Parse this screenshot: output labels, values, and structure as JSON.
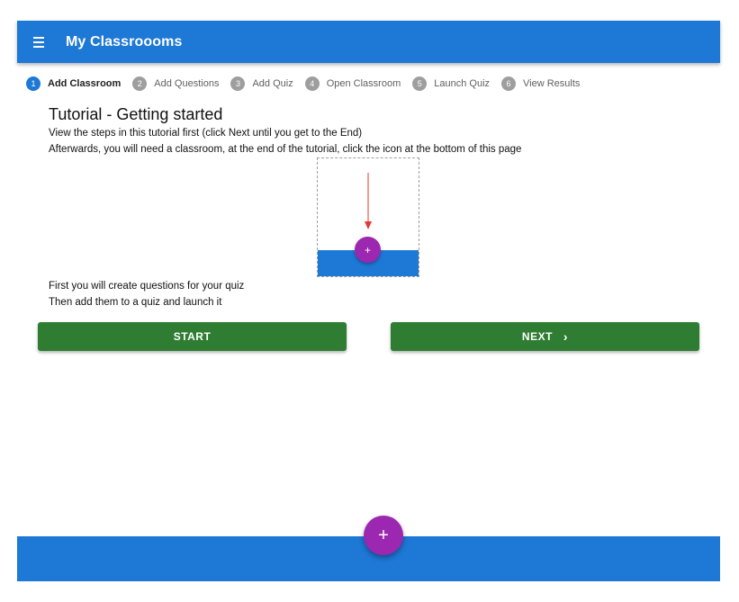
{
  "toolbar": {
    "title": "My Classroooms",
    "menu_icon": "menu-icon"
  },
  "stepper": {
    "steps": [
      {
        "number": "1",
        "label": "Add Classroom",
        "active": true
      },
      {
        "number": "2",
        "label": "Add Questions",
        "active": false
      },
      {
        "number": "3",
        "label": "Add Quiz",
        "active": false
      },
      {
        "number": "4",
        "label": "Open Classroom",
        "active": false
      },
      {
        "number": "5",
        "label": "Launch Quiz",
        "active": false
      },
      {
        "number": "6",
        "label": "View Results",
        "active": false
      }
    ]
  },
  "tutorial": {
    "heading": "Tutorial - Getting started",
    "line1": "View the steps in this tutorial first (click Next until you get to the End)",
    "line2": "Afterwards, you will need a classroom, at the end of the tutorial, click the icon at the bottom of this page",
    "illustration": {
      "fab_symbol": "+",
      "arrow_color": "#e53935"
    },
    "line3": "First you will create questions for your quiz",
    "line4": "Then add them to a quiz and launch it"
  },
  "buttons": {
    "start": "START",
    "next": "NEXT",
    "next_icon": "›"
  },
  "fab": {
    "symbol": "+"
  },
  "colors": {
    "primary": "#1e78d6",
    "accent": "#9c27b0",
    "button": "#2e7d32"
  }
}
